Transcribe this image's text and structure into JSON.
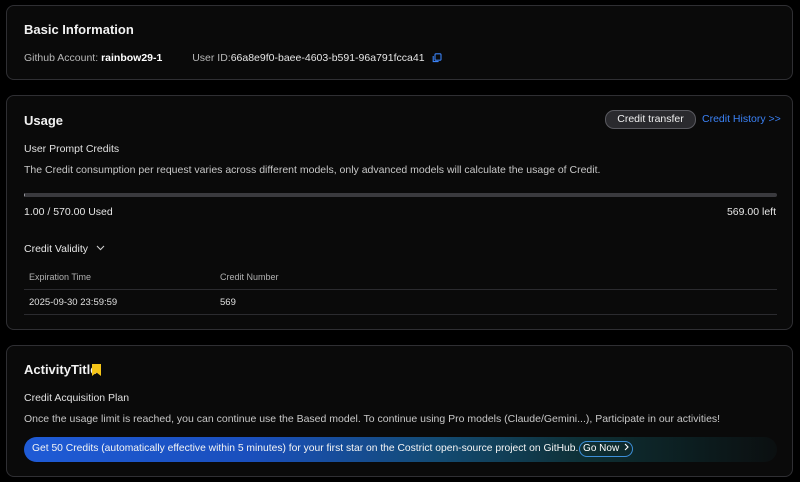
{
  "basic": {
    "title": "Basic Information",
    "github_label": "Github Account:",
    "github_value": "rainbow29-1",
    "user_id_label": "User ID:",
    "user_id_value": "66a8e9f0-baee-4603-b591-96a791fcca41"
  },
  "usage": {
    "title": "Usage",
    "credit_transfer": "Credit transfer",
    "credit_history": "Credit History >>",
    "section_label": "User Prompt Credits",
    "description": "The Credit consumption per request varies across different models,  only advanced models will calculate the usage of Credit.",
    "progress_fraction": 0.00175,
    "used_text": "1.00 / 570.00 Used",
    "left_text": "569.00 left",
    "validity_label": "Credit Validity",
    "table": {
      "headers": [
        "Expiration Time",
        "Credit Number"
      ],
      "rows": [
        [
          "2025-09-30 23:59:59",
          "569"
        ]
      ]
    }
  },
  "activity": {
    "title": "ActivityTitle",
    "plan_label": "Credit Acquisition Plan",
    "description": "Once the usage limit is reached,  you can continue use the Based model. To continue using Pro models (Claude/Gemini...), Participate in our activities!",
    "banner_text": "Get 50 Credits (automatically effective within 5 minutes) for your first star on the Costrict open-source project on GitHub.",
    "go_now": "Go Now"
  },
  "colors": {
    "link": "#3b82f6",
    "bookmark": "#f5c518",
    "banner_start": "#1f5bd6"
  }
}
